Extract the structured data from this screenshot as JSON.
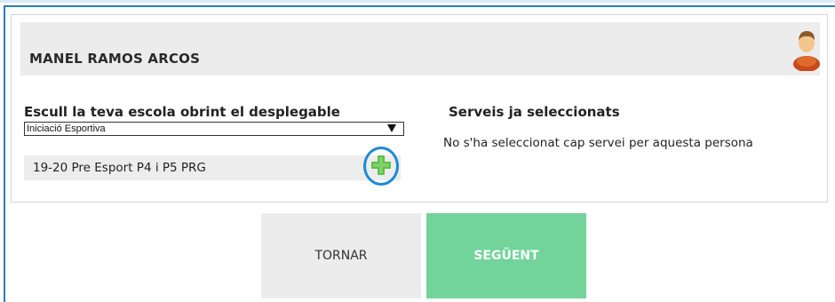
{
  "person": {
    "name": "MANEL RAMOS ARCOS",
    "avatar_icon": "user-avatar-icon"
  },
  "school_selector": {
    "title": "Escull la teva escola obrint el desplegable",
    "selected_value": "Iniciació Esportiva"
  },
  "available_service": {
    "label": "19-20 Pre Esport P4 i P5 PRG",
    "add_icon": "plus-icon",
    "highlight_color": "#1e8ad6"
  },
  "selected_services": {
    "title": "Serveis ja seleccionats",
    "empty_message": "No s'ha seleccionat cap servei per aquesta persona"
  },
  "actions": {
    "back_label": "TORNAR",
    "next_label": "SEGÜENT",
    "next_color": "#72d49a"
  }
}
